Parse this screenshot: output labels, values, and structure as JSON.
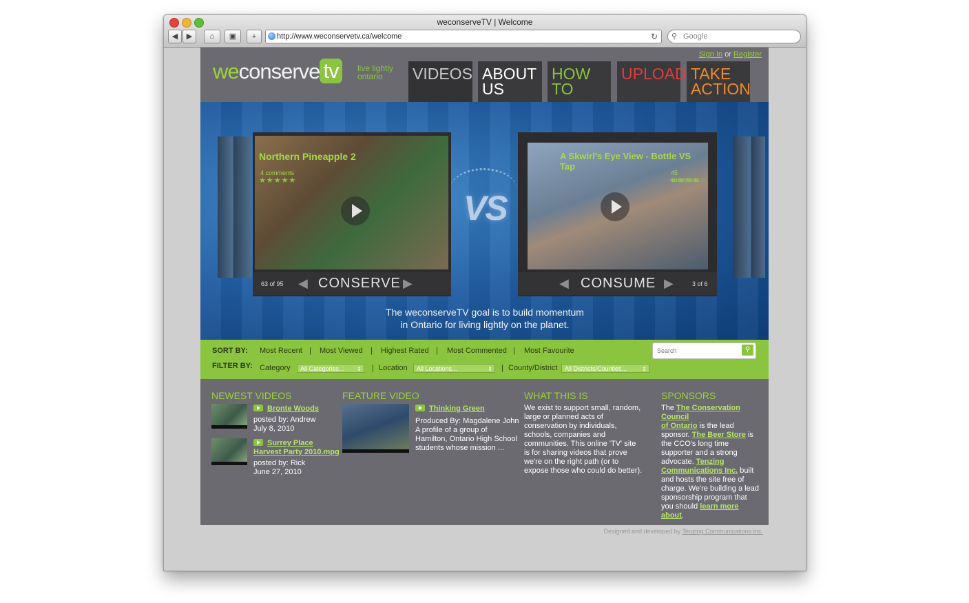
{
  "browser": {
    "title": "weconserveTV | Welcome",
    "url": "http://www.weconservetv.ca/welcome",
    "search_placeholder": "Google"
  },
  "auth": {
    "sign_in": "Sign In",
    "or": "or",
    "register": "Register"
  },
  "logo": {
    "we": "we",
    "conserve": "conserve",
    "tv": "tv",
    "tagline_1": "live lightly",
    "tagline_2": "ontario"
  },
  "nav": [
    {
      "line1": "VIDEOS",
      "line2": ""
    },
    {
      "line1": "ABOUT",
      "line2": "US"
    },
    {
      "line1": "HOW",
      "line2": "TO"
    },
    {
      "line1": "UPLOAD",
      "line2": ""
    },
    {
      "line1": "TAKE",
      "line2": "ACTION"
    }
  ],
  "hero": {
    "left": {
      "title": "Northern Pineapple 2",
      "comments": "4 comments",
      "stars": "★★★★★",
      "label": "CONSERVE",
      "count": "63 of 95"
    },
    "right": {
      "title": "A Skwirl's Eye View - Bottle VS Tap",
      "comments": "45 comments",
      "stars": "★★★★☆",
      "label": "CONSUME",
      "count": "3 of 6"
    },
    "vs": "VS",
    "goal_1": "The weconserveTV goal is to build momentum",
    "goal_2": "in Ontario for living lightly on the planet."
  },
  "filters": {
    "sort_label": "SORT BY:",
    "sort_options": [
      "Most Recent",
      "Most Viewed",
      "Highest Rated",
      "Most Commented",
      "Most Favourite"
    ],
    "filter_label": "FILTER BY:",
    "category_label": "Category",
    "category_value": "All Categories...",
    "location_label": "Location",
    "location_value": "All Locations...",
    "district_label": "County/District",
    "district_value": "All Districts/Counties...",
    "search_placeholder": "Search"
  },
  "newest": {
    "title": "NEWEST VIDEOS",
    "items": [
      {
        "title": "Bronte Woods",
        "title2": "",
        "posted": "posted by: Andrew",
        "date": "July 8, 2010"
      },
      {
        "title": "Surrey Place",
        "title2": "Harvest Party 2010.mpg",
        "posted": "posted by: Rick",
        "date": "June 27, 2010"
      }
    ]
  },
  "feature": {
    "title": "FEATURE VIDEO",
    "video_title": "Thinking Green",
    "desc": [
      "Produced By: Magdalene John",
      "A profile of a group of",
      "Hamilton, Ontario High School",
      "students whose mission ..."
    ]
  },
  "what": {
    "title": "WHAT THIS IS",
    "lines": [
      "We exist to support small, random,",
      "large or planned acts of",
      "conservation by individuals,",
      "schools, companies and",
      "communities. This online 'TV' site",
      "is for sharing videos that prove",
      "we're on the right path (or to",
      "expose those who could do better)."
    ]
  },
  "sponsors": {
    "title": "SPONSORS",
    "t1": "The ",
    "l1a": "The Conservation Council",
    "l1b": "of Ontario",
    "t2": " is the lead",
    "t3": "sponsor. ",
    "l2": "The Beer Store",
    "t4": " is",
    "t5": "the CCO's long time",
    "t6": "supporter and a strong",
    "t7": "advocate. ",
    "l3a": "Tenzing",
    "l3b": "Communications Inc.",
    "t8": " built",
    "t9": "and hosts the site free of",
    "t10": "charge. We're building a lead",
    "t11": "sponsorship program that",
    "t12": "you should ",
    "l4a": "learn more",
    "l4b": "about",
    "t13": "."
  },
  "footer": {
    "text": "Designed and developed by ",
    "link": "Tenzing Communications Inc."
  },
  "colors": {
    "green": "#8bc53f",
    "page_bg": "#6a6a70",
    "upload": "#e23b3b",
    "take_action": "#f08a2a"
  }
}
